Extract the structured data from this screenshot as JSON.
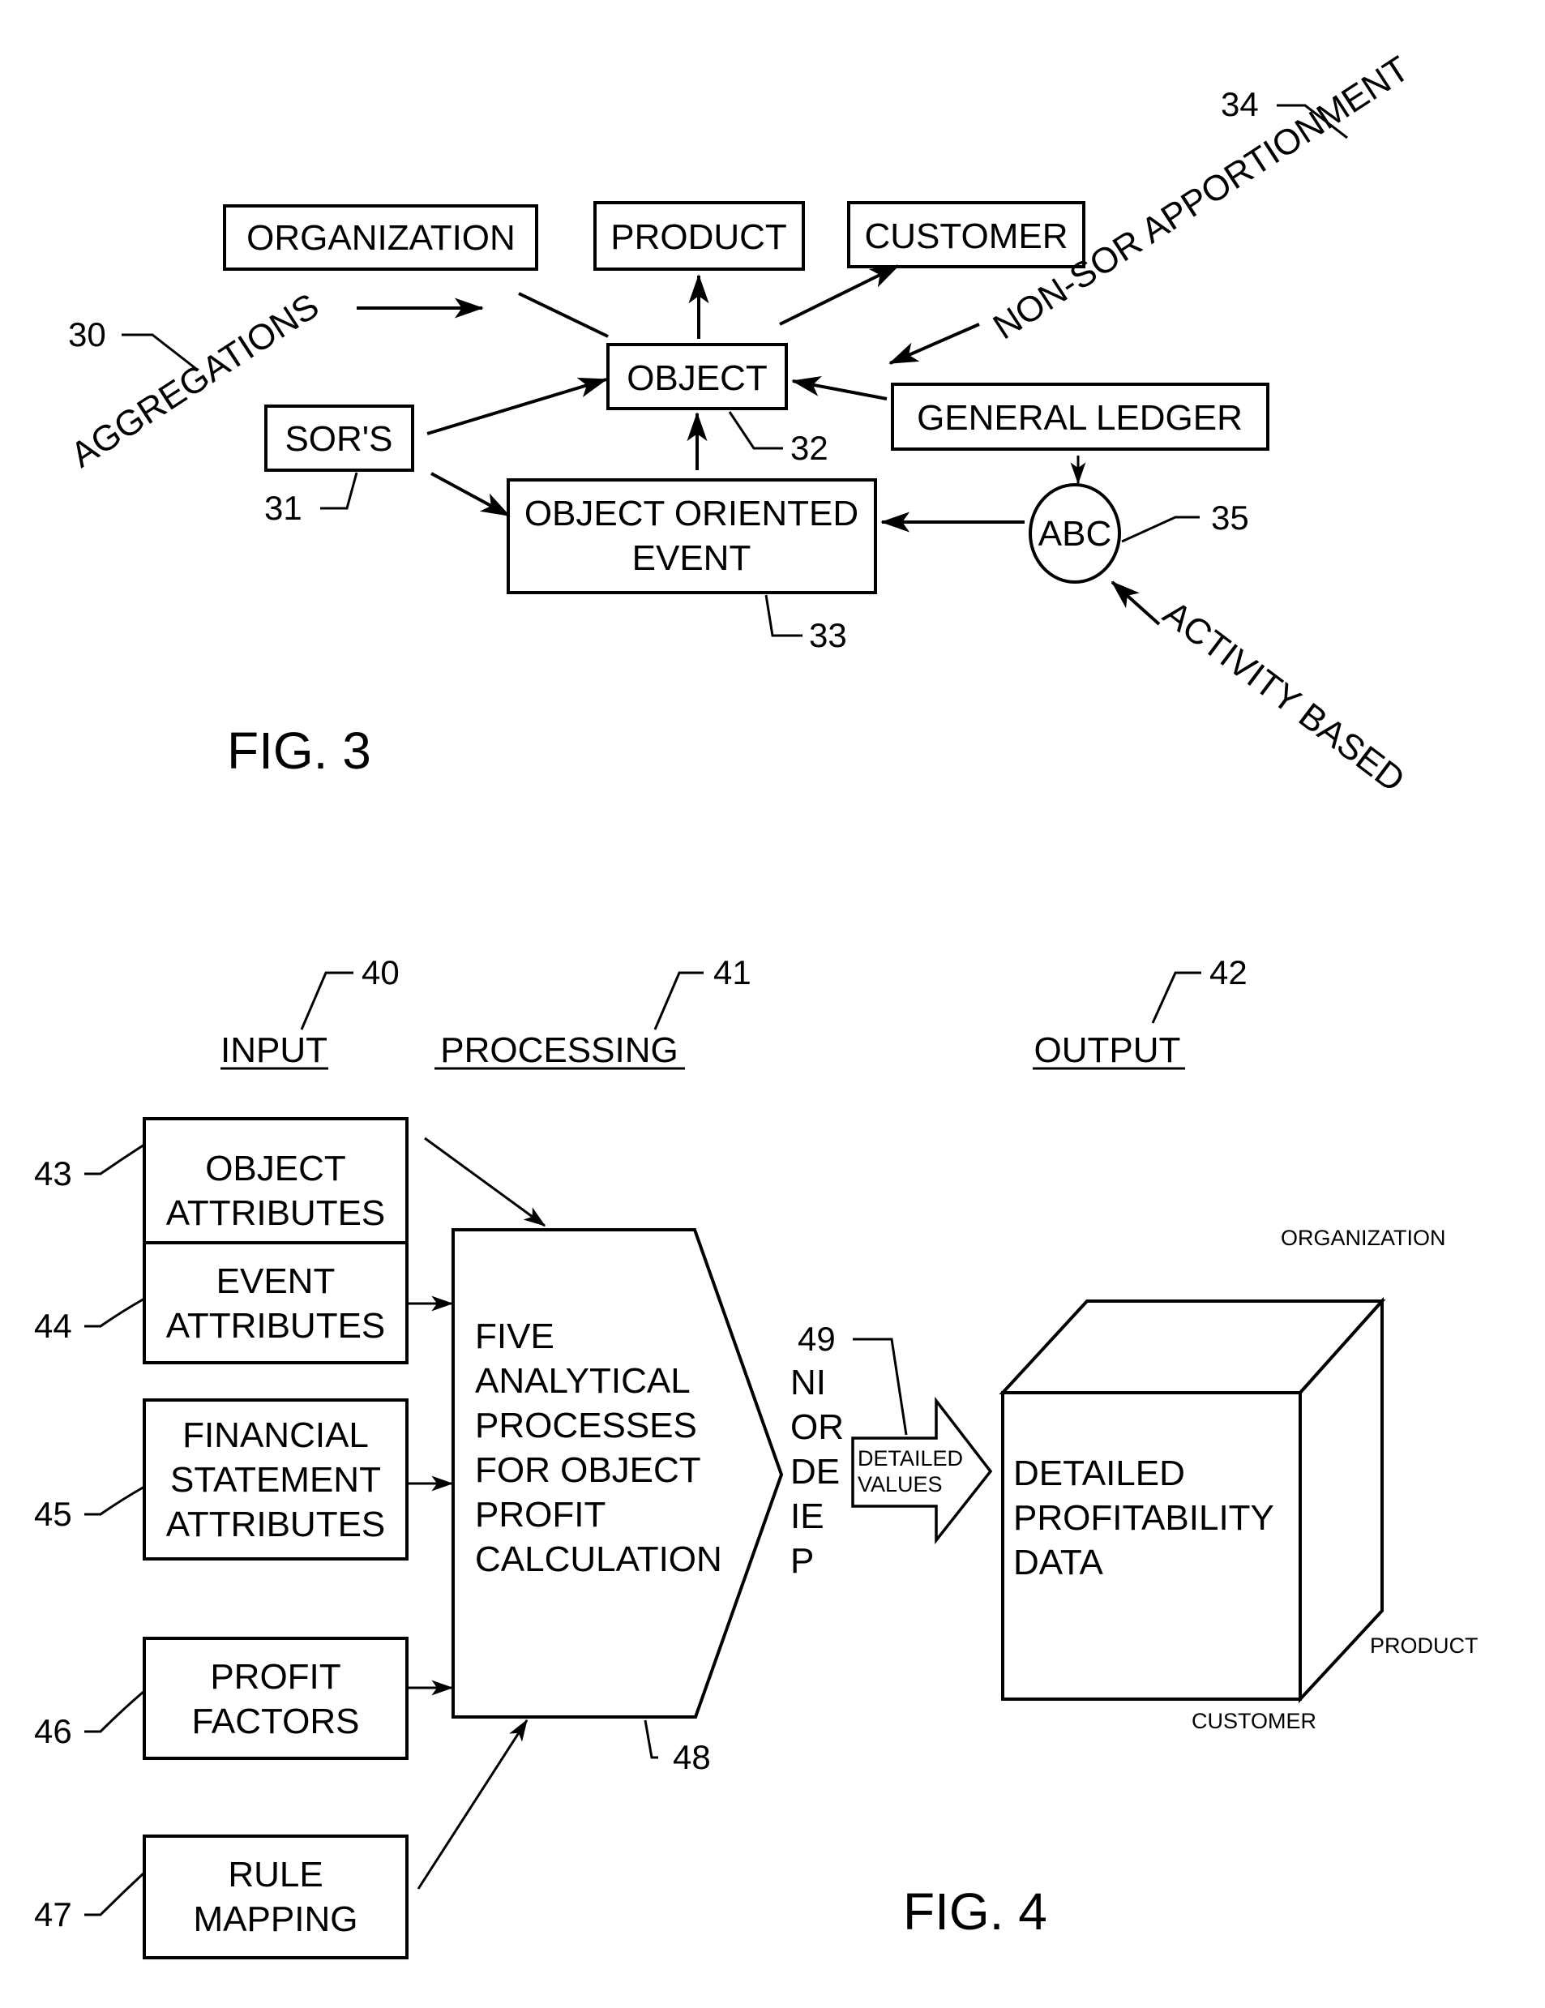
{
  "fig3": {
    "caption": "FIG. 3",
    "nodes": {
      "organization": "ORGANIZATION",
      "product": "PRODUCT",
      "customer": "CUSTOMER",
      "object": "OBJECT",
      "sors": "SOR'S",
      "general_ledger": "GENERAL LEDGER",
      "ooe_line1": "OBJECT ORIENTED",
      "ooe_line2": "EVENT",
      "abc": "ABC"
    },
    "labels": {
      "aggregations": "AGGREGATIONS",
      "non_sor": "NON-SOR APPORTIONMENT",
      "activity_based": "ACTIVITY BASED"
    },
    "refs": {
      "r30": "30",
      "r31": "31",
      "r32": "32",
      "r33": "33",
      "r34": "34",
      "r35": "35"
    }
  },
  "fig4": {
    "caption": "FIG. 4",
    "headings": {
      "input": "INPUT",
      "processing": "PROCESSING",
      "output": "OUTPUT"
    },
    "refs": {
      "r40": "40",
      "r41": "41",
      "r42": "42",
      "r43": "43",
      "r44": "44",
      "r45": "45",
      "r46": "46",
      "r47": "47",
      "r48": "48",
      "r49": "49"
    },
    "inputs": [
      {
        "line1": "OBJECT",
        "line2": "ATTRIBUTES"
      },
      {
        "line1": "EVENT",
        "line2": "ATTRIBUTES"
      },
      {
        "line1": "FINANCIAL",
        "line2": "STATEMENT",
        "line3": "ATTRIBUTES"
      },
      {
        "line1": "PROFIT",
        "line2": "FACTORS"
      },
      {
        "line1": "RULE",
        "line2": "MAPPING"
      }
    ],
    "processing_lines": [
      "FIVE",
      "ANALYTICAL",
      "PROCESSES",
      "FOR OBJECT",
      "PROFIT",
      "CALCULATION"
    ],
    "vertical_letters": [
      "NI",
      "OR",
      "DE",
      "IE",
      "P"
    ],
    "arrow_label": {
      "line1": "DETAILED",
      "line2": "VALUES"
    },
    "cube": {
      "line1": "DETAILED",
      "line2": "PROFITABILITY",
      "line3": "DATA",
      "axis_organization": "ORGANIZATION",
      "axis_product": "PRODUCT",
      "axis_customer": "CUSTOMER"
    }
  }
}
